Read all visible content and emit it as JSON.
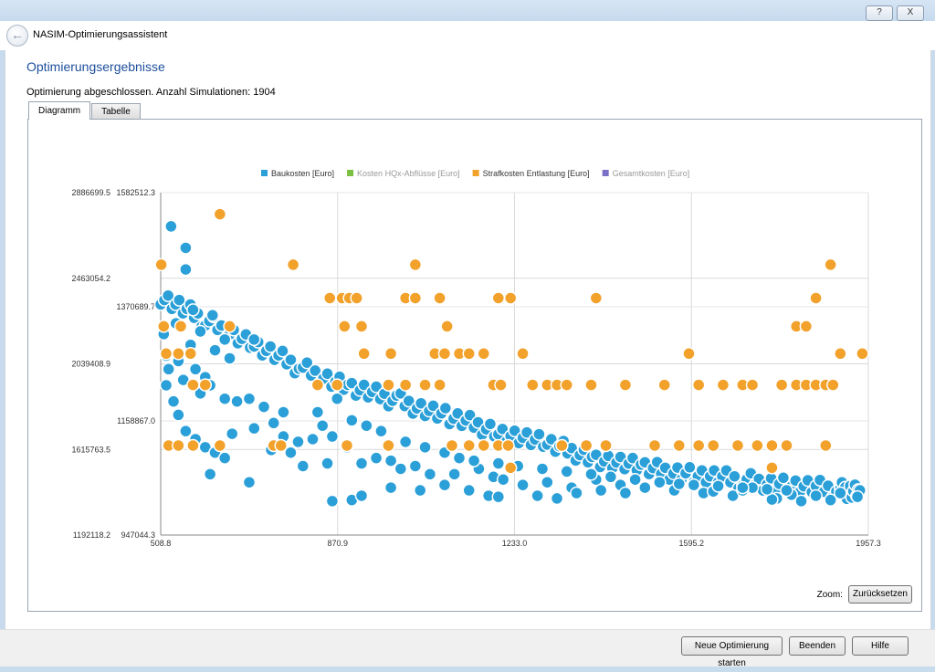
{
  "window": {
    "help_label": "?",
    "close_label": "X"
  },
  "wizard": {
    "title": "NASIM-Optimierungsassistent"
  },
  "page": {
    "heading": "Optimierungsergebnisse",
    "status": "Optimierung abgeschlossen. Anzahl Simulationen: 1904"
  },
  "tabs": [
    {
      "label": "Diagramm",
      "active": true
    },
    {
      "label": "Tabelle",
      "active": false
    }
  ],
  "zoom": {
    "label": "Zoom:",
    "reset_label": "Zurücksetzen"
  },
  "footer": {
    "new_label": "Neue Optimierung starten",
    "exit_label": "Beenden",
    "help_label": "Hilfe"
  },
  "chart_data": {
    "type": "scatter",
    "legend": [
      {
        "name": "Baukosten [Euro]",
        "color": "#2a9fd8",
        "active": true
      },
      {
        "name": "Kosten HQx-Abflüsse [Euro]",
        "color": "#7cc043",
        "active": false
      },
      {
        "name": "Strafkosten Entlastung [Euro]",
        "color": "#f2a12b",
        "active": true
      },
      {
        "name": "Gesamtkosten [Euro]",
        "color": "#7a6fc6",
        "active": false
      }
    ],
    "legend_position": "top-center",
    "grid": true,
    "x_ticks": [
      "508.8",
      "870.9",
      "1233.0",
      "1595.2",
      "1957.3"
    ],
    "xlim": [
      508.8,
      1957.3
    ],
    "y_left_ticks": [
      "2886699.5",
      "2463054.2",
      "2039408.9",
      "1615763.5",
      "1192118.2"
    ],
    "y_left_lim": [
      1192118.2,
      2886699.5
    ],
    "y_right_ticks": [
      "1582512.3",
      "1370689.7",
      "1158867.0",
      "947044.3"
    ],
    "y_right_lim": [
      947044.3,
      1582512.3
    ],
    "baukosten_trend": {
      "x": [
        508.8,
        600,
        700,
        800,
        900,
        1000,
        1100,
        1200,
        1300,
        1400,
        1500,
        1600,
        1700,
        1800,
        1900,
        1940
      ],
      "y": [
        1390000,
        1345000,
        1300000,
        1255000,
        1220000,
        1195000,
        1165000,
        1140000,
        1115000,
        1090000,
        1070000,
        1060000,
        1048000,
        1040000,
        1030000,
        1028000
      ]
    },
    "baukosten_scatter": [
      [
        530,
        1520000
      ],
      [
        560,
        1440000
      ],
      [
        590,
        1325000
      ],
      [
        615,
        1355000
      ],
      [
        640,
        1310000
      ],
      [
        620,
        1290000
      ],
      [
        570,
        1300000
      ],
      [
        545,
        1270000
      ],
      [
        580,
        1255000
      ],
      [
        600,
        1240000
      ],
      [
        555,
        1235000
      ],
      [
        515,
        1320000
      ],
      [
        520,
        1280000
      ],
      [
        525,
        1255000
      ],
      [
        535,
        1195000
      ],
      [
        545,
        1170000
      ],
      [
        590,
        1210000
      ],
      [
        610,
        1225000
      ],
      [
        640,
        1200000
      ],
      [
        665,
        1195000
      ],
      [
        690,
        1200000
      ],
      [
        720,
        1185000
      ],
      [
        560,
        1140000
      ],
      [
        580,
        1125000
      ],
      [
        600,
        1110000
      ],
      [
        620,
        1100000
      ],
      [
        655,
        1135000
      ],
      [
        700,
        1145000
      ],
      [
        740,
        1155000
      ],
      [
        760,
        1130000
      ],
      [
        790,
        1120000
      ],
      [
        820,
        1125000
      ],
      [
        860,
        1130000
      ],
      [
        890,
        1110000
      ],
      [
        610,
        1060000
      ],
      [
        640,
        1090000
      ],
      [
        690,
        1045000
      ],
      [
        735,
        1105000
      ],
      [
        775,
        1100000
      ],
      [
        800,
        1075000
      ],
      [
        850,
        1080000
      ],
      [
        920,
        1080000
      ],
      [
        950,
        1090000
      ],
      [
        980,
        1085000
      ],
      [
        1000,
        1070000
      ],
      [
        1030,
        1075000
      ],
      [
        1060,
        1060000
      ],
      [
        1110,
        1060000
      ],
      [
        1160,
        1070000
      ],
      [
        1190,
        1055000
      ],
      [
        1210,
        1050000
      ],
      [
        1250,
        1040000
      ],
      [
        1300,
        1045000
      ],
      [
        1350,
        1035000
      ],
      [
        1400,
        1050000
      ],
      [
        1450,
        1040000
      ],
      [
        1180,
        1020000
      ],
      [
        1200,
        1018000
      ],
      [
        1280,
        1020000
      ],
      [
        1320,
        1015000
      ],
      [
        1360,
        1025000
      ],
      [
        1410,
        1030000
      ],
      [
        1460,
        1025000
      ],
      [
        1500,
        1035000
      ],
      [
        860,
        1010000
      ],
      [
        900,
        1012000
      ],
      [
        920,
        1020000
      ],
      [
        980,
        1035000
      ],
      [
        1040,
        1030000
      ],
      [
        1090,
        1040000
      ],
      [
        1140,
        1030000
      ],
      [
        1560,
        1030000
      ],
      [
        1620,
        1025000
      ],
      [
        1680,
        1020000
      ],
      [
        1720,
        1035000
      ],
      [
        1770,
        1015000
      ],
      [
        1800,
        1022000
      ],
      [
        1850,
        1020000
      ],
      [
        1880,
        1012000
      ],
      [
        1900,
        1025000
      ],
      [
        1940,
        1030000
      ],
      [
        1935,
        1018000
      ],
      [
        1820,
        1010000
      ],
      [
        1760,
        1013000
      ],
      [
        1700,
        1030000
      ],
      [
        1640,
        1028000
      ],
      [
        1600,
        1040000
      ],
      [
        540,
        1340000
      ],
      [
        575,
        1365000
      ],
      [
        560,
        1480000
      ],
      [
        520,
        1225000
      ],
      [
        650,
        1275000
      ],
      [
        700,
        1310000
      ],
      [
        760,
        1175000
      ],
      [
        830,
        1175000
      ],
      [
        840,
        1150000
      ],
      [
        870,
        1200000
      ],
      [
        900,
        1160000
      ],
      [
        930,
        1150000
      ],
      [
        960,
        1140000
      ],
      [
        1010,
        1120000
      ],
      [
        1050,
        1110000
      ],
      [
        1090,
        1100000
      ],
      [
        1120,
        1090000
      ],
      [
        1150,
        1085000
      ],
      [
        1200,
        1080000
      ],
      [
        1240,
        1075000
      ],
      [
        1290,
        1070000
      ],
      [
        1340,
        1065000
      ],
      [
        1390,
        1060000
      ],
      [
        1430,
        1055000
      ],
      [
        1480,
        1050000
      ],
      [
        1530,
        1045000
      ],
      [
        1570,
        1042000
      ],
      [
        1650,
        1038000
      ],
      [
        1700,
        1035000
      ],
      [
        1750,
        1032000
      ],
      [
        1790,
        1030000
      ]
    ],
    "strafkosten_scatter": [
      [
        510,
        2530000
      ],
      [
        630,
        2780000
      ],
      [
        780,
        2530000
      ],
      [
        1030,
        2530000
      ],
      [
        1880,
        2530000
      ],
      [
        855,
        2365000
      ],
      [
        880,
        2365000
      ],
      [
        895,
        2365000
      ],
      [
        910,
        2365000
      ],
      [
        1010,
        2365000
      ],
      [
        1030,
        2365000
      ],
      [
        1080,
        2365000
      ],
      [
        1200,
        2365000
      ],
      [
        1225,
        2365000
      ],
      [
        1400,
        2365000
      ],
      [
        1850,
        2365000
      ],
      [
        515,
        2225000
      ],
      [
        550,
        2225000
      ],
      [
        650,
        2225000
      ],
      [
        885,
        2225000
      ],
      [
        920,
        2225000
      ],
      [
        1095,
        2225000
      ],
      [
        1810,
        2225000
      ],
      [
        1830,
        2225000
      ],
      [
        520,
        2090000
      ],
      [
        545,
        2090000
      ],
      [
        570,
        2090000
      ],
      [
        925,
        2090000
      ],
      [
        980,
        2090000
      ],
      [
        1070,
        2090000
      ],
      [
        1090,
        2090000
      ],
      [
        1120,
        2090000
      ],
      [
        1140,
        2090000
      ],
      [
        1170,
        2090000
      ],
      [
        1250,
        2090000
      ],
      [
        1590,
        2090000
      ],
      [
        1900,
        2090000
      ],
      [
        1945,
        2090000
      ],
      [
        575,
        1935000
      ],
      [
        600,
        1935000
      ],
      [
        830,
        1935000
      ],
      [
        870,
        1935000
      ],
      [
        975,
        1935000
      ],
      [
        1010,
        1935000
      ],
      [
        1050,
        1935000
      ],
      [
        1080,
        1935000
      ],
      [
        1190,
        1935000
      ],
      [
        1205,
        1935000
      ],
      [
        1270,
        1935000
      ],
      [
        1300,
        1935000
      ],
      [
        1320,
        1935000
      ],
      [
        1340,
        1935000
      ],
      [
        1390,
        1935000
      ],
      [
        1460,
        1935000
      ],
      [
        1540,
        1935000
      ],
      [
        1610,
        1935000
      ],
      [
        1660,
        1935000
      ],
      [
        1700,
        1935000
      ],
      [
        1720,
        1935000
      ],
      [
        1780,
        1935000
      ],
      [
        1810,
        1935000
      ],
      [
        1830,
        1935000
      ],
      [
        1850,
        1935000
      ],
      [
        1870,
        1935000
      ],
      [
        1885,
        1935000
      ],
      [
        525,
        1635000
      ],
      [
        545,
        1635000
      ],
      [
        575,
        1635000
      ],
      [
        630,
        1635000
      ],
      [
        740,
        1635000
      ],
      [
        755,
        1635000
      ],
      [
        890,
        1635000
      ],
      [
        975,
        1635000
      ],
      [
        1105,
        1635000
      ],
      [
        1140,
        1635000
      ],
      [
        1170,
        1635000
      ],
      [
        1200,
        1635000
      ],
      [
        1220,
        1635000
      ],
      [
        1330,
        1635000
      ],
      [
        1380,
        1635000
      ],
      [
        1420,
        1635000
      ],
      [
        1520,
        1635000
      ],
      [
        1570,
        1635000
      ],
      [
        1610,
        1635000
      ],
      [
        1640,
        1635000
      ],
      [
        1690,
        1635000
      ],
      [
        1730,
        1635000
      ],
      [
        1760,
        1635000
      ],
      [
        1790,
        1635000
      ],
      [
        1870,
        1635000
      ],
      [
        1225,
        1525000
      ],
      [
        1760,
        1525000
      ]
    ]
  }
}
